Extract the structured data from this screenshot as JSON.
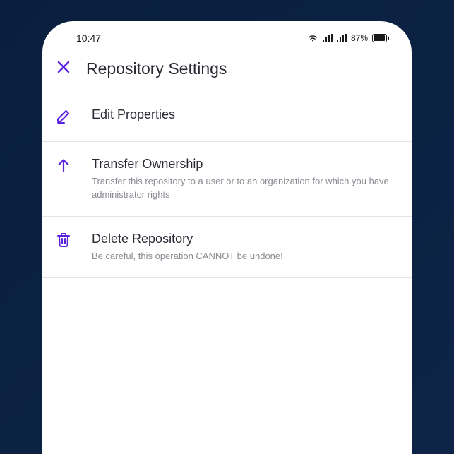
{
  "status": {
    "time": "10:47",
    "battery_pct": "87%"
  },
  "header": {
    "title": "Repository Settings"
  },
  "colors": {
    "accent": "#5B21E0",
    "text": "#2a2a35",
    "muted": "#8a8a92"
  },
  "items": [
    {
      "icon": "edit",
      "title": "Edit Properties",
      "subtitle": null
    },
    {
      "icon": "arrow-up",
      "title": "Transfer Ownership",
      "subtitle": "Transfer this repository to a user or to an organization for which you have administrator rights"
    },
    {
      "icon": "trash",
      "title": "Delete Repository",
      "subtitle": "Be careful, this operation CANNOT be undone!"
    }
  ]
}
